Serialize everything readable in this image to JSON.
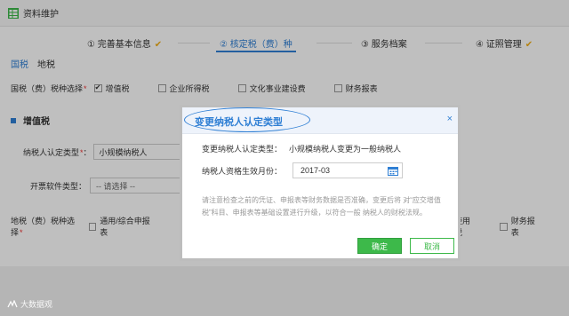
{
  "window": {
    "title": "资料维护",
    "icon": "table-grid-icon"
  },
  "steps": [
    {
      "label": "① 完善基本信息",
      "done": true,
      "active": false
    },
    {
      "label": "② 核定税（费）种",
      "done": false,
      "active": true
    },
    {
      "label": "③ 服务档案",
      "done": false,
      "active": false
    },
    {
      "label": "④ 证照管理",
      "done": true,
      "active": false
    }
  ],
  "check_mark": "✔",
  "tabs": [
    {
      "label": "国税",
      "active": true
    },
    {
      "label": "地税",
      "active": false
    }
  ],
  "national_tax": {
    "label": "国税（费）税种选择",
    "required": "*",
    "options": [
      {
        "label": "增值税",
        "checked": true
      },
      {
        "label": "企业所得税",
        "checked": false
      },
      {
        "label": "文化事业建设费",
        "checked": false
      },
      {
        "label": "财务报表",
        "checked": false
      }
    ]
  },
  "section": {
    "title": "增值税"
  },
  "form": {
    "taxpayer_type_label": "纳税人认定类型",
    "taxpayer_type_value": "小规模纳税人",
    "software_label": "开票软件类型：",
    "software_value": "-- 请选择 --"
  },
  "local_tax": {
    "label": "地税（费）税种选择",
    "required": "*",
    "options": [
      {
        "label": "通用/综合申报表",
        "checked": false
      },
      {
        "label": "使用税",
        "checked": false
      },
      {
        "label": "财务报表",
        "checked": false
      }
    ]
  },
  "modal": {
    "title": "变更纳税人认定类型",
    "close": "×",
    "type_label": "变更纳税人认定类型：",
    "type_value": "小规模纳税人变更为一般纳税人",
    "month_label": "纳税人资格生效月份：",
    "month_value": "2017-03",
    "notice": "请注意检查之前的凭证、申报表等财务数据是否准确，变更后将 对“应交增值税”科目、申报表等基础设置进行升级，以符合一般 纳税人的财税法规。",
    "ok_label": "确定",
    "cancel_label": "取消"
  },
  "watermark": "大数据观",
  "colors": {
    "accent": "#2f7fd4",
    "success": "#3db94a",
    "check": "#f0ae19",
    "required": "#e33333"
  }
}
